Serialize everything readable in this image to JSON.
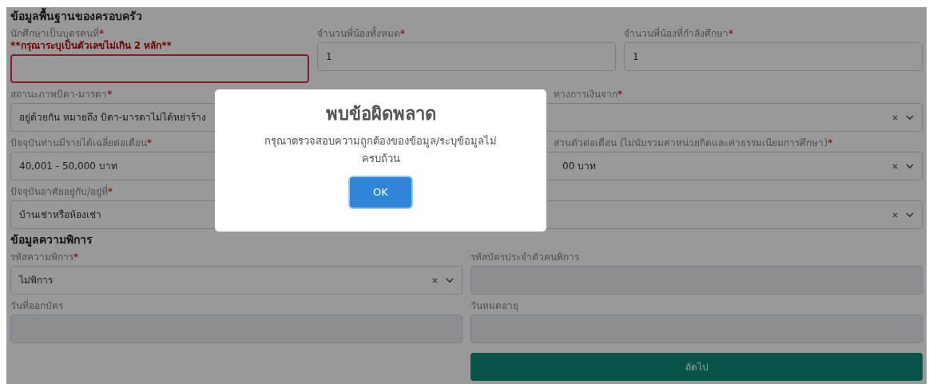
{
  "sections": [
    {
      "title": "ข้อมูลพื้นฐานของครอบครัว",
      "rows": [
        {
          "fields": [
            {
              "label": "นักศึกษาเป็นบุตรคนที่",
              "mark": "*",
              "error": "**กรุณาระบุเป็นตัวเลขไม่เกิน 2 หลัก**",
              "kind": "input",
              "invalid": true
            },
            {
              "label": "จำนวนพี่น้องทั้งหมด",
              "mark": "*",
              "value": "1",
              "kind": "input",
              "invalid": false
            },
            {
              "label": "จำนวนพี่น้องที่กำลังศึกษา",
              "mark": "*",
              "value": "1",
              "kind": "input",
              "invalid": false
            }
          ]
        },
        {
          "fields": [
            {
              "label": "สถานะภาพบิดา-มารดา",
              "mark": "*",
              "value": "อยู่ด้วยกัน หมายถึง บิดา-มารดาไม่ได้หย่าร้าง",
              "kind": "select",
              "invalid": false
            },
            {
              "label": "ทางการเงินจาก",
              "mark": "*",
              "kind": "select",
              "invalid": false
            }
          ]
        },
        {
          "fields": [
            {
              "label": "ปัจจุบันท่านมีรายได้เฉลี่ยต่อเดือน",
              "mark": "*",
              "value": "40,001 - 50,000 บาท",
              "kind": "select",
              "invalid": false
            },
            {
              "label": "ส่วนตัวต่อเดือน (ไม่นับรวมค่าหน่วยกิตและค่าธรรมเนียมการศึกษา)",
              "mark": "*",
              "value": "00 บาท",
              "kind": "select",
              "invalid": false
            }
          ]
        },
        {
          "fields": [
            {
              "label": "ปัจจุบันอาศัยอยู่กับ/อยู่ที่",
              "mark": "*",
              "value": "บ้านเช่าหรือห้องเช่า",
              "kind": "select",
              "invalid": false
            },
            {
              "kind": "select",
              "invalid": false
            }
          ]
        }
      ]
    },
    {
      "title": "ข้อมูลความพิการ",
      "rows": [
        {
          "fields": [
            {
              "label": "รหัสความพิการ",
              "mark": "*",
              "value": "ไม่พิการ",
              "kind": "select",
              "invalid": false
            },
            {
              "label": "รหัสบัตรประจำตัวคนพิการ",
              "kind": "disabled",
              "invalid": false
            }
          ]
        },
        {
          "fields": [
            {
              "label": "วันที่ออกบัตร",
              "kind": "disabled",
              "invalid": false
            },
            {
              "label": "วันหมดอายุ",
              "kind": "disabled",
              "invalid": false
            }
          ]
        }
      ]
    }
  ],
  "next_button": "ถัดไป",
  "dialog": {
    "title": "พบข้อผิดพลาด",
    "message": "กรุณาตรวจสอบความถูกต้องของข้อมูล/ระบุข้อมูลไม่ครบถ้วน",
    "confirm": "OK"
  }
}
